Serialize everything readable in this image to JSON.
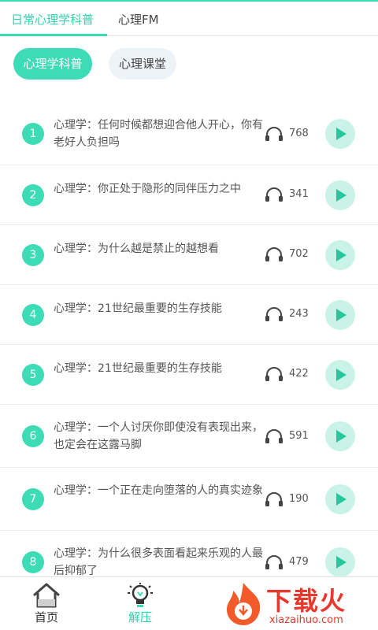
{
  "tabs": [
    {
      "label": "日常心理学科普",
      "active": true
    },
    {
      "label": "心理FM",
      "active": false
    }
  ],
  "chips": [
    {
      "label": "心理学科普",
      "active": true
    },
    {
      "label": "心理课堂",
      "active": false
    }
  ],
  "items": [
    {
      "num": "1",
      "title": "心理学：任何时候都想迎合他人开心，你有老好人负担吗",
      "count": "768"
    },
    {
      "num": "2",
      "title": "心理学：你正处于隐形的同伴压力之中",
      "count": "341"
    },
    {
      "num": "3",
      "title": "心理学：为什么越是禁止的越想看",
      "count": "702"
    },
    {
      "num": "4",
      "title": "心理学：21世纪最重要的生存技能",
      "count": "243"
    },
    {
      "num": "5",
      "title": "心理学：21世纪最重要的生存技能",
      "count": "422"
    },
    {
      "num": "6",
      "title": "心理学：一个人讨厌你即使没有表现出来，也定会在这露马脚",
      "count": "591"
    },
    {
      "num": "7",
      "title": "心理学：一个正在走向堕落的人的真实迹象",
      "count": "190"
    },
    {
      "num": "8",
      "title": "心理学：为什么很多表面看起来乐观的人最后抑郁了",
      "count": "479"
    }
  ],
  "bottom_nav": [
    {
      "label": "首页",
      "icon": "home-icon",
      "active": false
    },
    {
      "label": "解压",
      "icon": "lightbulb-icon",
      "active": true
    }
  ],
  "watermark": {
    "brand": "下载火",
    "url": "xiazaihuo.com"
  },
  "colors": {
    "accent": "#3ddbb6",
    "play_bg": "#c9f3e6",
    "watermark": "#e8382c"
  }
}
